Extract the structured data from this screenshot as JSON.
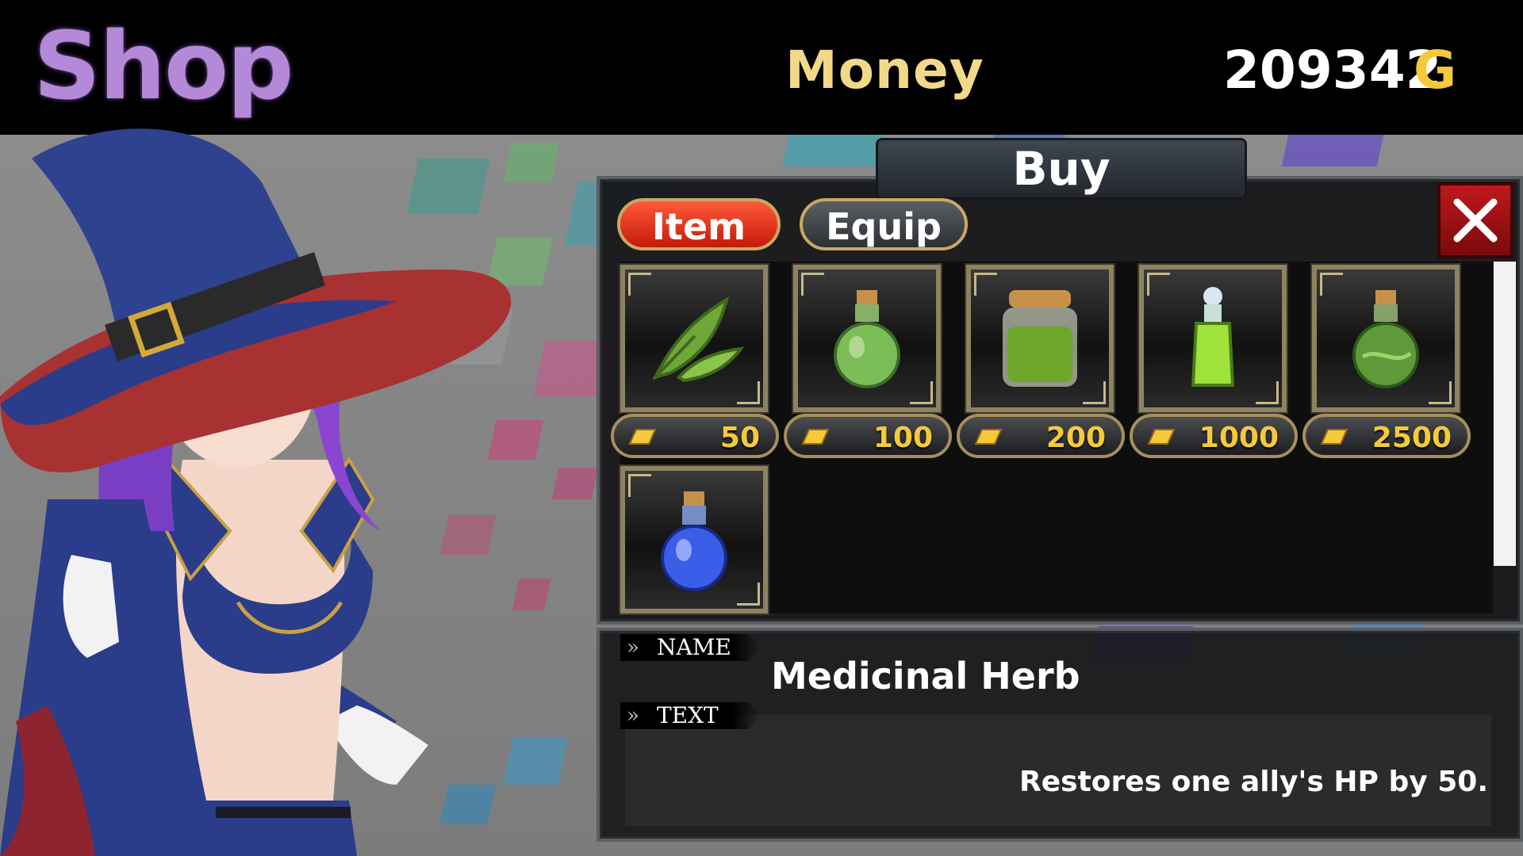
{
  "header": {
    "title": "Shop",
    "money_label": "Money",
    "money_value": "209342",
    "money_unit": "G"
  },
  "panel": {
    "title": "Buy",
    "tabs": [
      {
        "label": "Item",
        "active": true
      },
      {
        "label": "Equip",
        "active": false
      }
    ],
    "close_icon": "close-x-icon",
    "items": [
      {
        "icon": "herb-leaf-icon",
        "price": "50",
        "color": "#6fa83a"
      },
      {
        "icon": "green-potion-icon",
        "price": "100",
        "color": "#7bbd56"
      },
      {
        "icon": "green-jar-icon",
        "price": "200",
        "color": "#6ea82a"
      },
      {
        "icon": "lime-vial-icon",
        "price": "1000",
        "color": "#9fe23a"
      },
      {
        "icon": "green-flask-icon",
        "price": "2500",
        "color": "#5f9a3a"
      },
      {
        "icon": "blue-potion-icon",
        "price": "",
        "color": "#3a5ee8"
      }
    ]
  },
  "details": {
    "name_label": "NAME",
    "name_value": "Medicinal Herb",
    "text_label": "TEXT",
    "text_value": "Restores one ally's HP by 50."
  },
  "colors": {
    "active_tab": "#e8321e",
    "gold": "#f5c93a",
    "money_label": "#f2d98a",
    "title": "#b48ad8"
  }
}
